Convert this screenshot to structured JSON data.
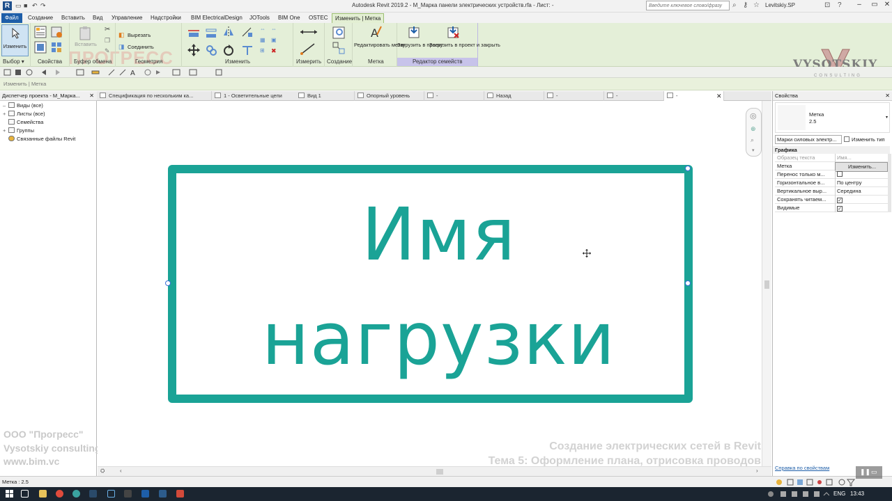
{
  "titlebar": {
    "title": "Autodesk Revit 2019.2 - М_Марка панели электрических устройств.rfa - Лист: -",
    "search_placeholder": "Введите ключевое слово/фразу",
    "user": "Levitskiy.SP"
  },
  "menu_tabs": [
    "Файл",
    "Создание",
    "Вставить",
    "Вид",
    "Управление",
    "Надстройки",
    "BIM ElectricalDesign",
    "JOTools",
    "BIM One",
    "OSTEC",
    "Изменить | Метка"
  ],
  "ribbon": {
    "modify_label": "Изменить",
    "insert_label": "Вставить",
    "cut_label": "Вырезать",
    "join_label": "Соединить",
    "edit_tag_label": "Редактировать метку",
    "load_project_label": "Загрузить в проект",
    "load_close_label": "Загрузить в проект и закрыть",
    "groups": [
      "Выбор ▾",
      "Свойства",
      "Буфер обмена",
      "Геометрия",
      "Изменить",
      "Измерить",
      "Создание",
      "Метка",
      "Редактор семейств"
    ]
  },
  "context_bar": "Изменить | Метка",
  "project_browser": {
    "title": "Диспетчер проекта - М_Марка...",
    "items": [
      "Виды (все)",
      "Листы (все)",
      "Семейства",
      "Группы",
      "Связанные файлы Revit"
    ]
  },
  "view_tabs": [
    "Спецификация по нескольким ка...",
    "1 - Осветительные цепи",
    "Вид 1",
    "Опорный уровень",
    "-",
    "Назад",
    "-",
    "-",
    "-"
  ],
  "canvas": {
    "line1": "Имя",
    "line2": "нагрузки"
  },
  "properties": {
    "title": "Свойства",
    "type_name": "Метка",
    "type_value": "2.5",
    "family_select": "Марки силовых электр...",
    "edit_type": "Изменить тип",
    "section": "Графика",
    "rows": [
      {
        "key": "Образец текста",
        "value": "Имя..."
      },
      {
        "key": "Метка",
        "value": "Изменить..."
      },
      {
        "key": "Перенос только м...",
        "value": ""
      },
      {
        "key": "Горизонтальное в...",
        "value": "По центру"
      },
      {
        "key": "Вертикальное выр...",
        "value": "Середина"
      },
      {
        "key": "Сохранять читаем...",
        "value": "✓"
      },
      {
        "key": "Видимые",
        "value": "✓"
      }
    ],
    "help_link": "Справка по свойствам"
  },
  "status": {
    "text": "Метка : 2.5"
  },
  "taskbar": {
    "lang": "ENG",
    "time": "13:43"
  },
  "watermarks": {
    "company": "ООО \"Прогресс\"",
    "consulting": "Vysotskiy consulting",
    "site": "www.bim.vc",
    "course": "Создание электрических сетей в Revit",
    "topic": "Тема 5: Оформление плана, отрисовка проводов",
    "logo": "VYSOTSKIY",
    "logo_sub": "CONSULTING",
    "progress": "ПРОГРЕСС"
  },
  "colors": {
    "accent": "#1aa396",
    "ribbon": "#e4efd8",
    "file_tab": "#1e5ea8"
  }
}
